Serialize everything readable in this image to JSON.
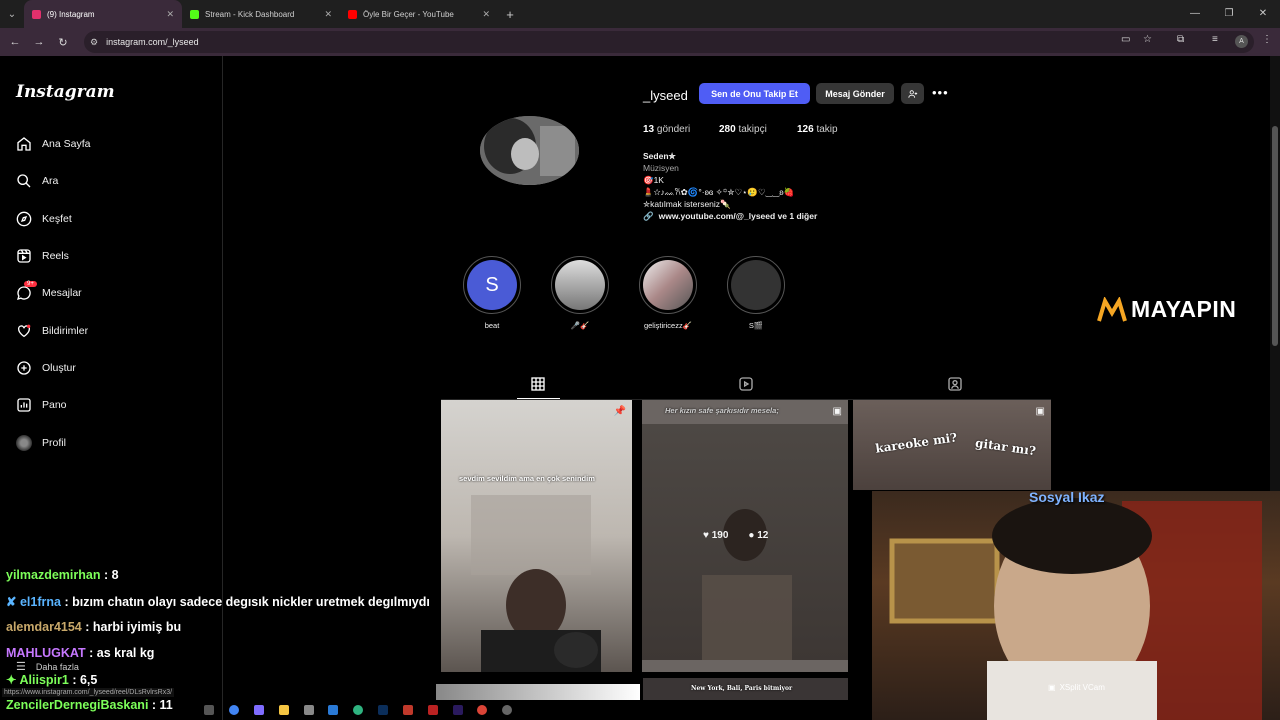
{
  "browser": {
    "tabs": [
      {
        "title": "(9) Instagram",
        "color": "#e1306c",
        "active": true
      },
      {
        "title": "Stream - Kick Dashboard",
        "color": "#53fc18",
        "active": false
      },
      {
        "title": "Öyle Bir Geçer - YouTube",
        "color": "#ff0000",
        "active": false
      }
    ],
    "url": "instagram.com/_lyseed",
    "new_tab": "+",
    "avatar_letter": "A"
  },
  "sidebar": {
    "logo": "Instagram",
    "items": [
      {
        "label": "Ana Sayfa",
        "icon": "home-icon"
      },
      {
        "label": "Ara",
        "icon": "search-icon"
      },
      {
        "label": "Keşfet",
        "icon": "compass-icon"
      },
      {
        "label": "Reels",
        "icon": "reels-icon"
      },
      {
        "label": "Mesajlar",
        "icon": "messenger-icon",
        "badge": "9+"
      },
      {
        "label": "Bildirimler",
        "icon": "heart-icon"
      },
      {
        "label": "Oluştur",
        "icon": "plus-square-icon"
      },
      {
        "label": "Pano",
        "icon": "chart-icon"
      },
      {
        "label": "Profil",
        "icon": "profile-icon"
      }
    ],
    "more": "Daha fazla"
  },
  "profile": {
    "username": "_lyseed",
    "follow_label": "Sen de Onu Takip Et",
    "message_label": "Mesaj Gönder",
    "posts_count": "13",
    "posts_label": "gönderi",
    "followers_count": "280",
    "followers_label": "takipçi",
    "following_count": "126",
    "following_label": "takip",
    "name": "Seden✮",
    "category": "Müzisyen",
    "bio_line1": "🎯1K",
    "bio_line2": "💄☆♪ᨐ𐙚✿🌀°·ʚɞ ✧꙳✮♡⋆🥲♡‿‿ʚ🍓",
    "bio_line3": "✮katılmak isterseniz🍡",
    "link": "www.youtube.com/@_lyseed ve 1 diğer"
  },
  "highlights": [
    {
      "label": "beat",
      "letter": "S"
    },
    {
      "label": "🎤🎸"
    },
    {
      "label": "geliştiricezz🎸"
    },
    {
      "label": "S🎬"
    }
  ],
  "posts": [
    {
      "overlay": "sevdim sevildim ama en çok senindim"
    },
    {
      "overlay": "Her kızın safe şarkısıdır mesela;",
      "likes": "190",
      "comments": "12"
    },
    {
      "overlay_a": "kareoke mi?",
      "overlay_b": "gitar mı?"
    },
    {
      "overlay": "New York, Bali, Paris bitmiyor"
    }
  ],
  "overlay": {
    "brand": "MAYAPIN",
    "webcam_title": "Sosyal Ikaz",
    "webcam_label": "XSplit VCam"
  },
  "chat": [
    {
      "user": "yilmazdemirhan",
      "msg": ": 8",
      "color": "#7dff5a"
    },
    {
      "user": "el1frna",
      "msg": ": bızım chatın olayı sadece degısık nickler uretmek degılmıydı",
      "color": "#5ab4ff"
    },
    {
      "user": "alemdar4154",
      "msg": ": harbi iyimiş bu",
      "color": "#c8a86a"
    },
    {
      "user": "MAHLUGKAT",
      "msg": ": as kral kg",
      "color": "#c678ff"
    },
    {
      "user": "Aliispir1",
      "msg": ": 6,5",
      "color": "#7dff5a"
    },
    {
      "user": "ZencilerDernegiBaskani",
      "msg": ": 11",
      "color": "#7dff5a"
    }
  ],
  "status_url": "https://www.instagram.com/_lyseed/reel/DLsRvlrsRx3/"
}
